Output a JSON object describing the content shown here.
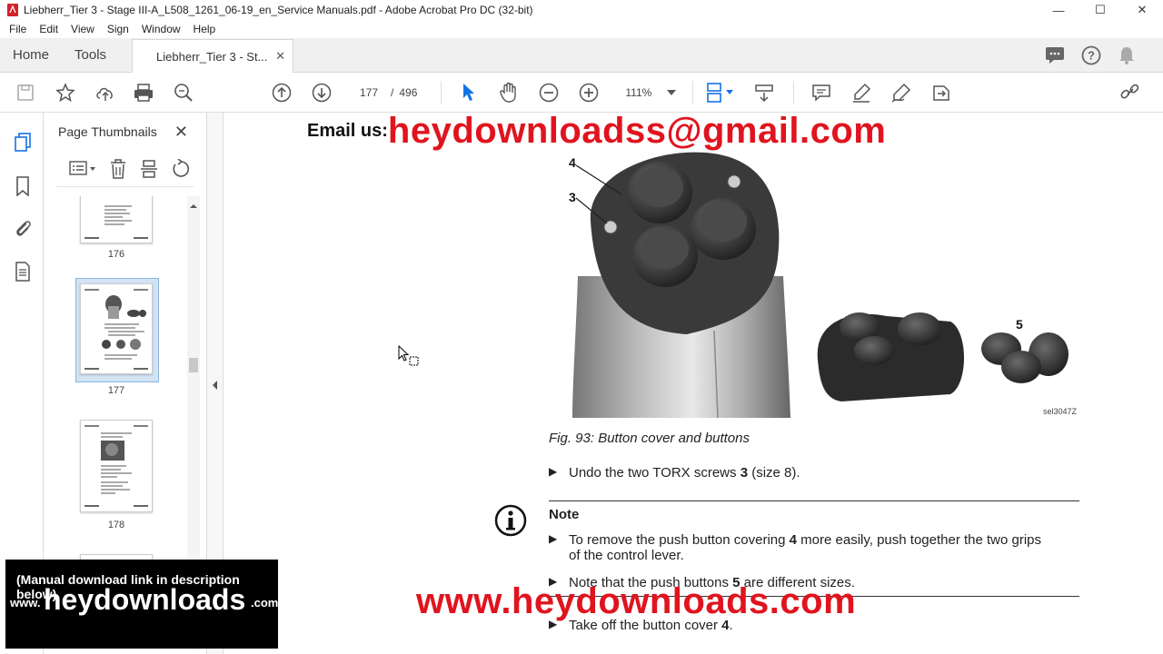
{
  "window": {
    "title": "Liebherr_Tier 3 - Stage III-A_L508_1261_06-19_en_Service Manuals.pdf - Adobe Acrobat Pro DC (32-bit)",
    "minimize": "—",
    "maximize": "☐",
    "close": "✕"
  },
  "menu": [
    "File",
    "Edit",
    "View",
    "Sign",
    "Window",
    "Help"
  ],
  "tabs": {
    "home": "Home",
    "tools": "Tools",
    "document": "Liebherr_Tier 3 - St...",
    "close": "✕"
  },
  "toolbar": {
    "current_page": "177",
    "separator": "/",
    "total_pages": "496",
    "zoom": "111%"
  },
  "panel": {
    "title": "Page Thumbnails",
    "close": "✕",
    "thumbnails": [
      {
        "page": "176"
      },
      {
        "page": "177",
        "selected": true
      },
      {
        "page": "178"
      }
    ]
  },
  "document": {
    "email_label": "Email us:",
    "email_address": "heydownloadss@gmail.com",
    "callouts": {
      "c4": "4",
      "c3": "3",
      "c5": "5"
    },
    "image_code": "sel3047Z",
    "caption": "Fig. 93: Button cover and buttons",
    "step1_pre": "Undo the two TORX screws ",
    "step1_bold": "3",
    "step1_post": " (size 8).",
    "note_title": "Note",
    "note1_pre": "To remove the push button covering ",
    "note1_bold": "4",
    "note1_post": " more easily, push together the two grips",
    "note1_line2": "of the control lever.",
    "note2_pre": "Note that the push buttons ",
    "note2_bold": "5",
    "note2_post": " are different sizes.",
    "step2_pre": "Take off the button cover ",
    "step2_bold": "4",
    "step2_post": ".",
    "watermark_url": "www.heydownloads.com"
  },
  "promo": {
    "line1": "(Manual download link in description below)",
    "www": "www.",
    "brand": "heydownloads",
    "com": ".com"
  },
  "colors": {
    "watermark_red": "#e0141e",
    "selection_blue": "#d2e3f3",
    "acrobat_red": "#d4202a"
  }
}
